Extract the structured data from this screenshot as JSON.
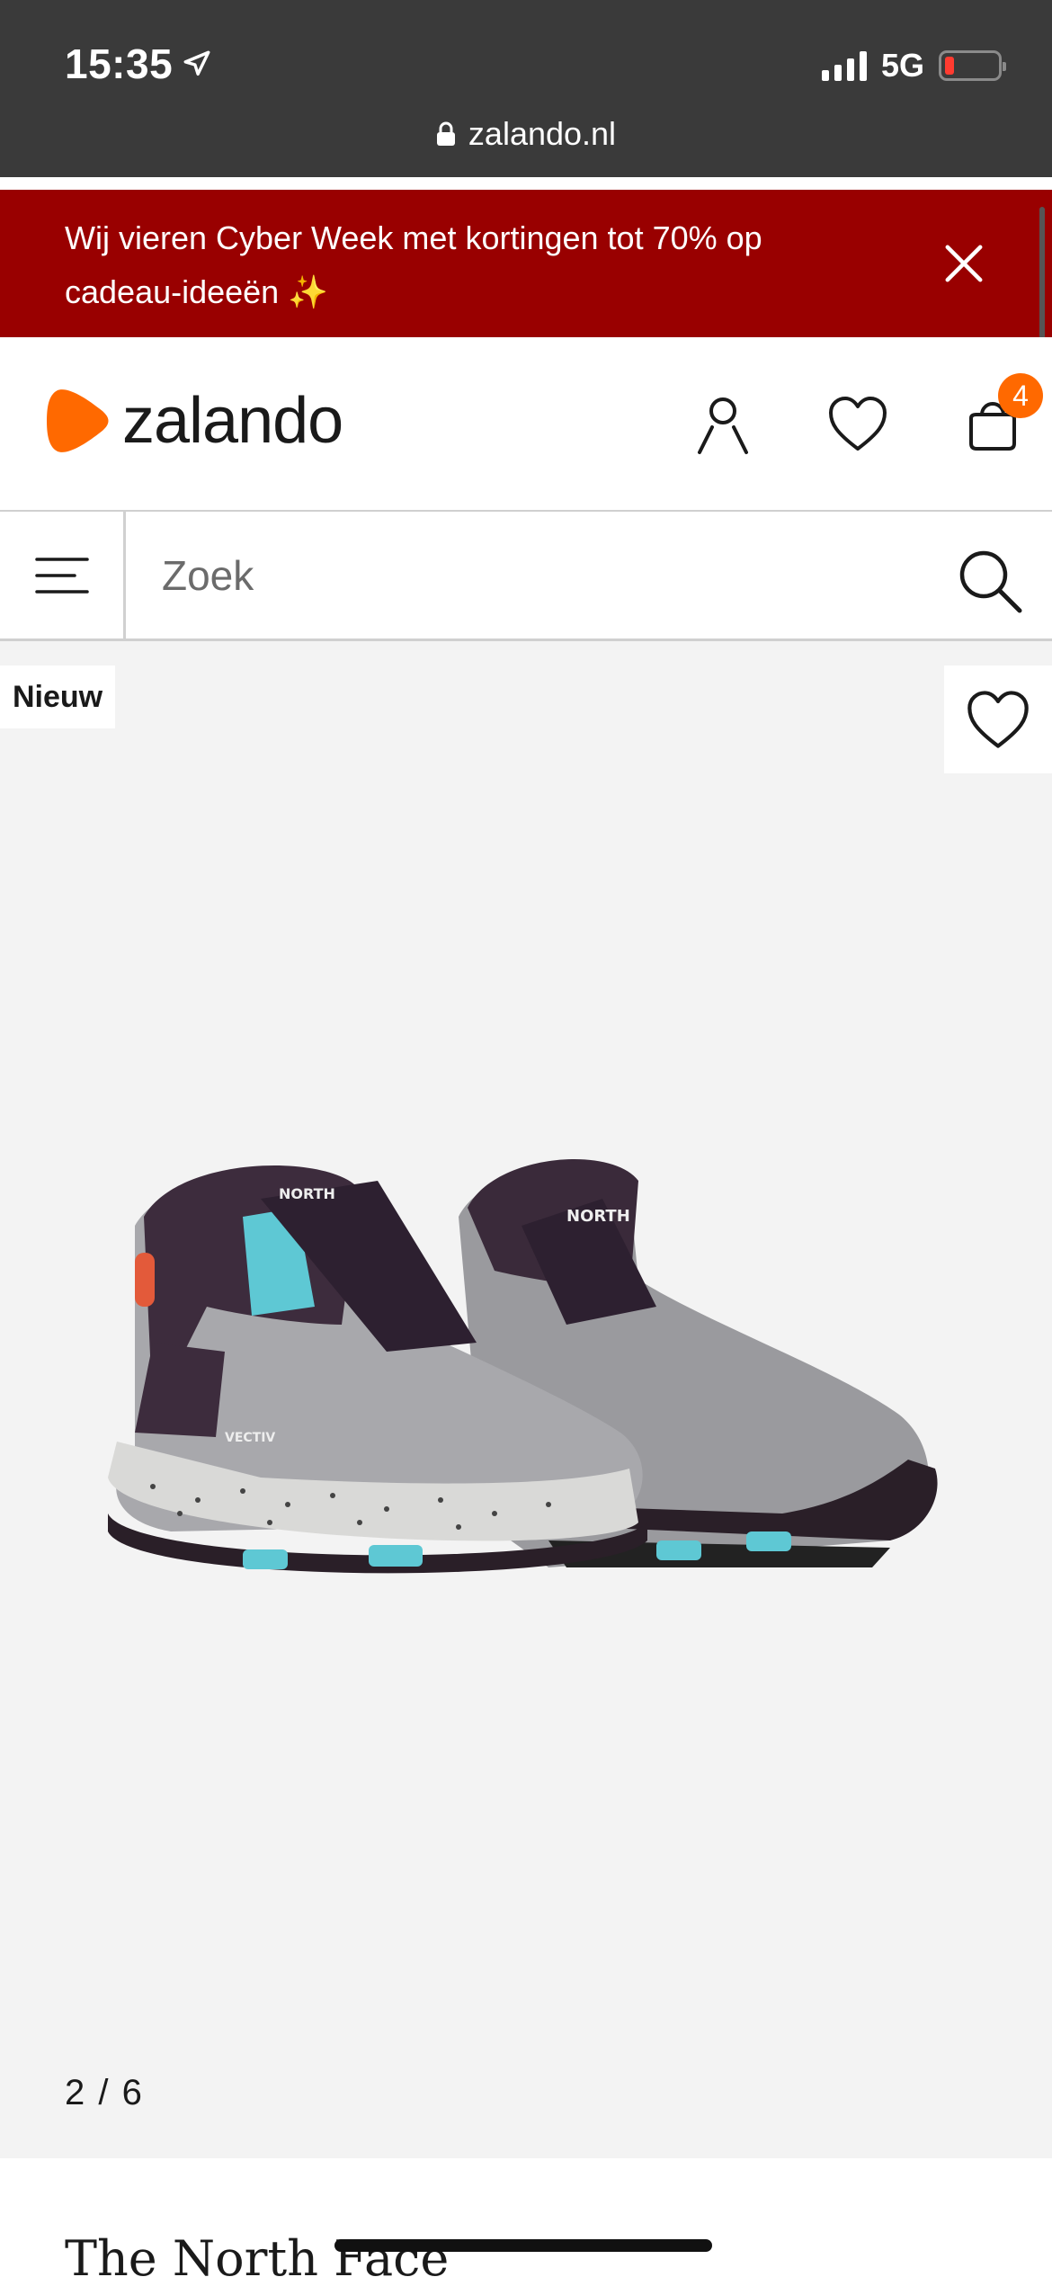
{
  "status_bar": {
    "time": "15:35",
    "network": "5G"
  },
  "browser": {
    "url": "zalando.nl"
  },
  "promo": {
    "text": "Wij vieren Cyber Week met kortingen tot 70% op cadeau-ideeën ✨"
  },
  "header": {
    "logo_text": "zalando",
    "cart_count": "4"
  },
  "search": {
    "placeholder": "Zoek"
  },
  "product": {
    "badge": "Nieuw",
    "pager": "2 / 6",
    "brand": "The North Face"
  },
  "colors": {
    "promo_bg": "#990000",
    "accent": "#ff6900",
    "status_bg": "#3a3a3a"
  }
}
